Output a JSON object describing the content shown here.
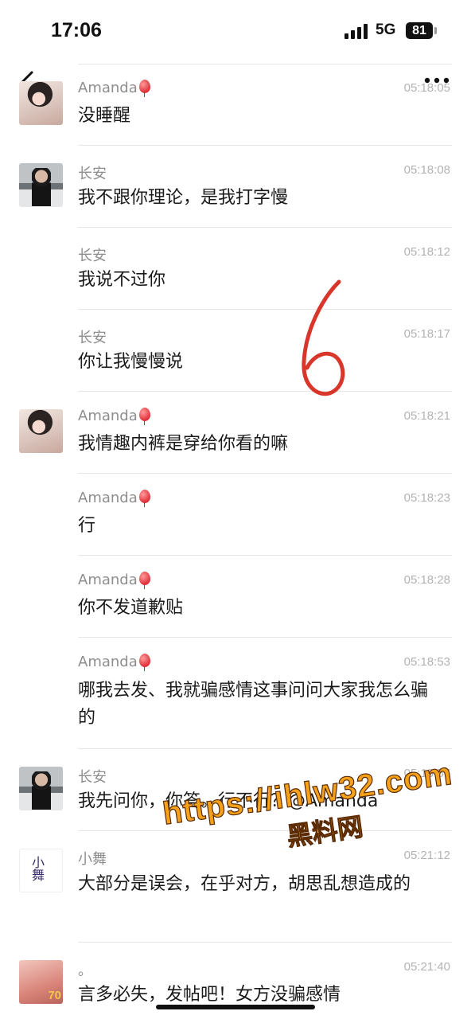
{
  "status_bar": {
    "time": "17:06",
    "network": "5G",
    "battery": "81"
  },
  "icons": {
    "back": "chevron-left-icon",
    "more": "more-dots-icon",
    "signal": "signal-bars-icon",
    "battery": "battery-icon"
  },
  "messages": [
    {
      "sender": "Amanda",
      "time": "05:18:05",
      "text": "没睡醒",
      "avatar": "amanda-avatar"
    },
    {
      "sender": "长安",
      "time": "05:18:08",
      "text": "我不跟你理论，是我打字慢",
      "avatar": "changan-avatar"
    },
    {
      "sender": "长安",
      "time": "05:18:12",
      "text": "我说不过你",
      "avatar": ""
    },
    {
      "sender": "长安",
      "time": "05:18:17",
      "text": "你让我慢慢说",
      "avatar": ""
    },
    {
      "sender": "Amanda",
      "time": "05:18:21",
      "text": "我情趣内裤是穿给你看的嘛",
      "avatar": "amanda-avatar"
    },
    {
      "sender": "Amanda",
      "time": "05:18:23",
      "text": "行",
      "avatar": ""
    },
    {
      "sender": "Amanda",
      "time": "05:18:28",
      "text": "你不发道歉贴",
      "avatar": ""
    },
    {
      "sender": "Amanda",
      "time": "05:18:53",
      "text": "哪我去发、我就骗感情这事问问大家我怎么骗的",
      "avatar": ""
    },
    {
      "sender": "长安",
      "time": "05:18:57",
      "text": "我先问你，你答。行不行？@Amanda",
      "avatar": "changan-avatar"
    },
    {
      "sender": "小舞",
      "time": "05:21:12",
      "text": "大部分是误会，在乎对方，胡思乱想造成的",
      "avatar": "xiaowu-avatar"
    },
    {
      "sender": "。",
      "time": "05:21:40",
      "text": "言多必失，发帖吧！女方没骗感情",
      "avatar": "dot-avatar"
    }
  ],
  "avatars": {
    "xiaowu_glyph": "小舞",
    "dot_badge": "70"
  },
  "overlay": {
    "handwritten": "6",
    "watermark_url": "https://ihlw32.com",
    "watermark_cn": "黑料网"
  },
  "colors": {
    "accent_orange": "#f5a21a",
    "ink_red": "#d8362a",
    "time_gray": "#b3b3b3",
    "name_gray": "#8e8e8e"
  }
}
